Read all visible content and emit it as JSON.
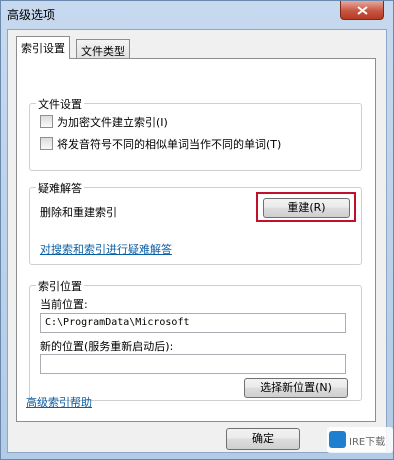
{
  "window": {
    "title": "高级选项"
  },
  "tabs": [
    {
      "label": "索引设置",
      "active": true
    },
    {
      "label": "文件类型",
      "active": false
    }
  ],
  "file_settings": {
    "title": "文件设置",
    "options": [
      {
        "label": "为加密文件建立索引(I)",
        "checked": false
      },
      {
        "label": "将发音符号不同的相似单词当作不同的单词(T)",
        "checked": false
      }
    ]
  },
  "troubleshoot": {
    "title": "疑难解答",
    "rebuild_text": "删除和重建索引",
    "rebuild_button": "重建(R)",
    "link": "对搜索和索引进行疑难解答"
  },
  "index_location": {
    "title": "索引位置",
    "current_label": "当前位置:",
    "current_value": "C:\\ProgramData\\Microsoft",
    "new_label": "新的位置(服务重新启动后):",
    "new_value": "",
    "select_button": "选择新位置(N)"
  },
  "footer": {
    "help_link": "高级索引帮助",
    "ok_button": "确定"
  },
  "watermark": {
    "text": "IRE下载"
  },
  "colors": {
    "highlight": "#c0112a",
    "link": "#0b5fa5"
  }
}
